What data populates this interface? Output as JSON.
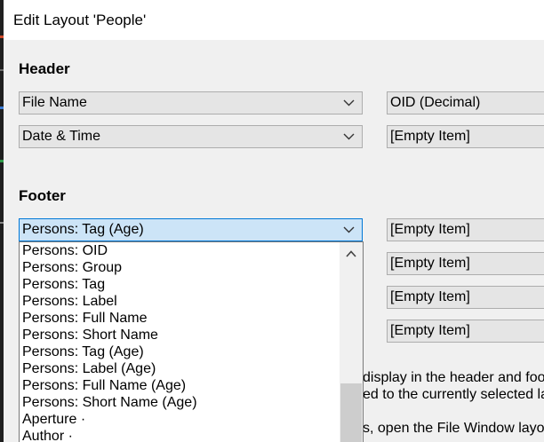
{
  "window": {
    "title": "Edit Layout 'People'"
  },
  "header_section": {
    "label": "Header",
    "rows": [
      {
        "left": "File Name",
        "right": "OID (Decimal)"
      },
      {
        "left": "Date & Time",
        "right": "[Empty Item]"
      }
    ]
  },
  "footer_section": {
    "label": "Footer",
    "selected": "Persons: Tag (Age)",
    "right_items": [
      "[Empty Item]",
      "[Empty Item]",
      "[Empty Item]",
      "[Empty Item]"
    ]
  },
  "dropdown": {
    "options": [
      "Persons: OID",
      "Persons: Group",
      "Persons: Tag",
      "Persons: Label",
      "Persons: Full Name",
      "Persons: Short Name",
      "Persons: Tag (Age)",
      "Persons: Label (Age)",
      "Persons: Full Name (Age)",
      "Persons: Short Name (Age)",
      "Aperture ·",
      "Author ·"
    ]
  },
  "obscured_text": {
    "line1": "display in the header and foot",
    "line2": "ed to the currently selected la",
    "line3": "s, open the File Window layou"
  },
  "icons": {
    "chevron": "chevron-down-icon",
    "scroll_up": "chevron-up-icon"
  },
  "colors": {
    "selected_bg": "#cce4f7",
    "selected_border": "#0078d7",
    "combo_bg": "#e5e5e5"
  }
}
